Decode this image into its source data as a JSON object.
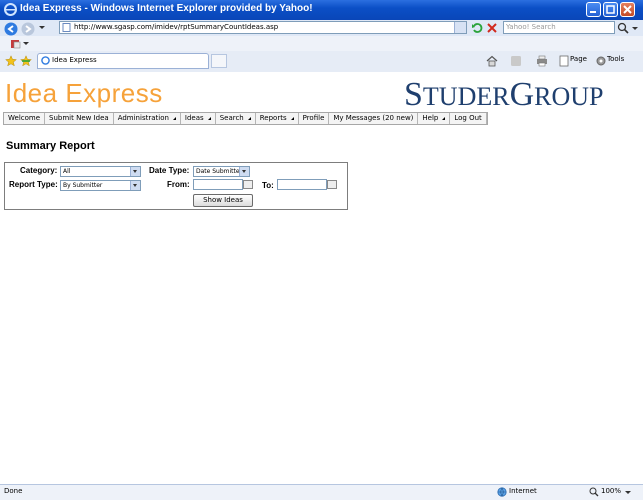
{
  "window": {
    "title": "Idea Express - Windows Internet Explorer provided by Yahoo!"
  },
  "address": {
    "url": "http://www.sgasp.com/imidev/rptSummaryCountIdeas.asp",
    "search_placeholder": "Yahoo! Search"
  },
  "tabs": {
    "active_label": "Idea Express"
  },
  "command_bar": {
    "page_label": "Page",
    "tools_label": "Tools"
  },
  "site": {
    "brand": "Idea Express",
    "logo_big_1": "S",
    "logo_small_1": "TUDER",
    "logo_big_2": "G",
    "logo_small_2": "ROUP"
  },
  "menu": [
    {
      "label": "Welcome",
      "arrow": false
    },
    {
      "label": "Submit New Idea",
      "arrow": false
    },
    {
      "label": "Administration",
      "arrow": true
    },
    {
      "label": "Ideas",
      "arrow": true
    },
    {
      "label": "Search",
      "arrow": true
    },
    {
      "label": "Reports",
      "arrow": true
    },
    {
      "label": "Profile",
      "arrow": false
    },
    {
      "label": "My Messages (20 new)",
      "arrow": false
    },
    {
      "label": "Help",
      "arrow": true
    },
    {
      "label": "Log Out",
      "arrow": false
    }
  ],
  "page": {
    "heading": "Summary Report"
  },
  "form": {
    "category_label": "Category:",
    "category_value": "All",
    "report_type_label": "Report Type:",
    "report_type_value": "By Submitter",
    "date_type_label": "Date Type:",
    "date_type_value": "Date Submitted",
    "from_label": "From:",
    "to_label": "To:",
    "show_button": "Show Ideas"
  },
  "status": {
    "left": "Done",
    "zone": "Internet",
    "zoom": "100%"
  },
  "colors": {
    "titlebar": "#0b4fc6",
    "brand_orange": "#f6a23a",
    "logo_navy": "#1f3f6e"
  },
  "icons": [
    "ie-icon",
    "back-icon",
    "forward-icon",
    "refresh-icon",
    "stop-icon",
    "search-go-icon",
    "favorites-star-icon",
    "add-favorites-icon",
    "home-icon",
    "feeds-icon",
    "print-icon",
    "page-icon",
    "tools-gear-icon",
    "calendar-icon",
    "globe-icon",
    "zoom-icon"
  ]
}
